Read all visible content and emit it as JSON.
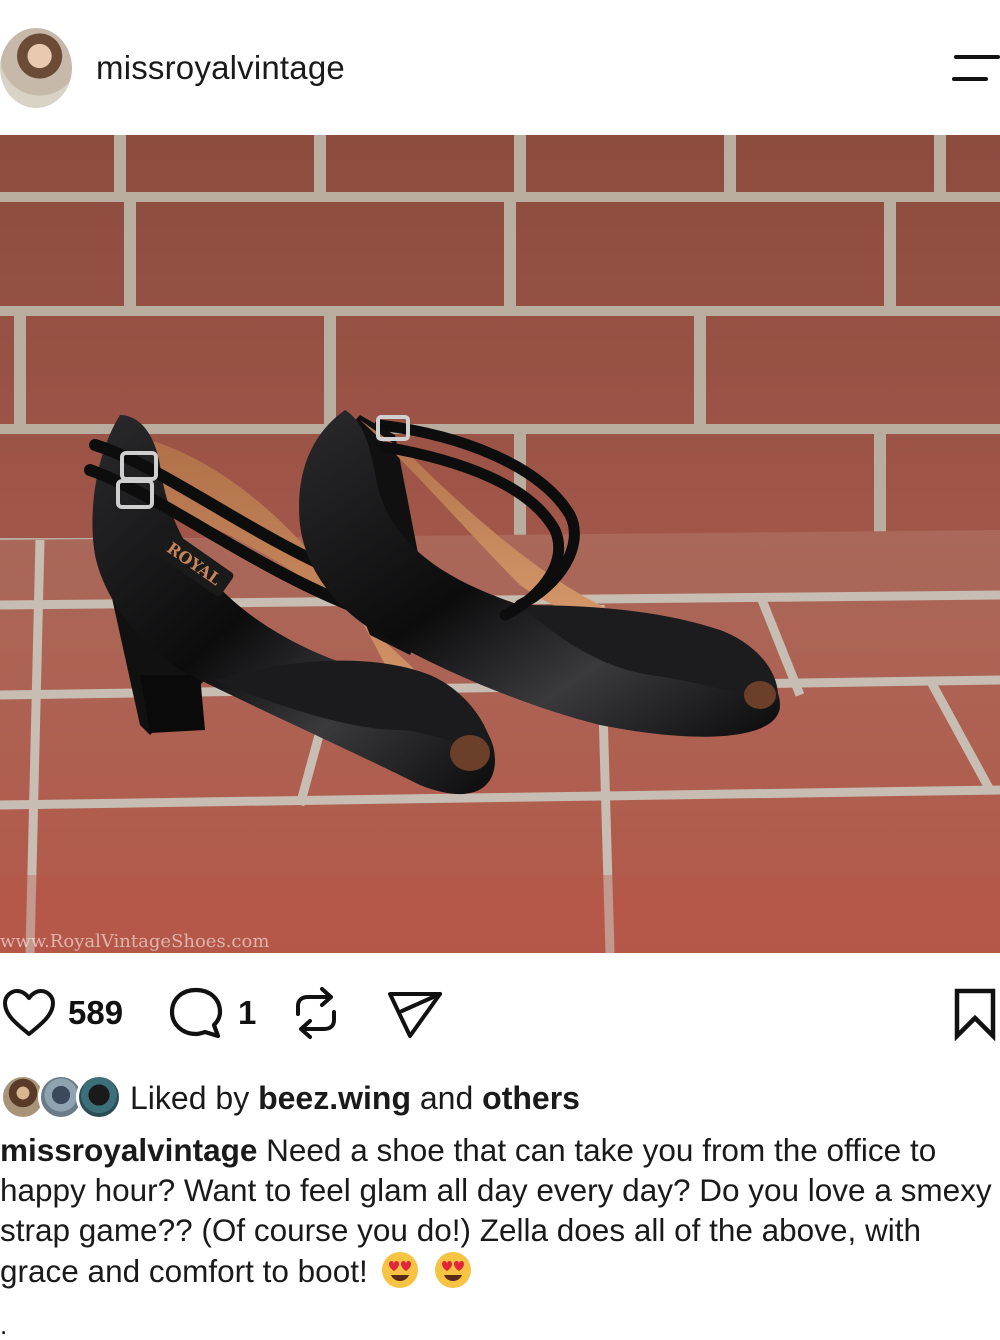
{
  "header": {
    "username": "missroyalvintage"
  },
  "post": {
    "watermark": "www.RoyalVintageShoes.com",
    "insole_brand": "ROYAL"
  },
  "actions": {
    "like_count": "589",
    "comment_count": "1"
  },
  "likes": {
    "prefix": "Liked by",
    "user": "beez.wing",
    "joiner": "and",
    "others": "others"
  },
  "caption": {
    "author": "missroyalvintage",
    "text": "Need a shoe that can take you from the office to happy hour? Want to feel glam all day every day? Do you love a smexy strap game?? (Of course you do!) Zella does all of the above, with grace and comfort to boot!",
    "emojis": [
      "heart-eyes-emoji",
      "heart-eyes-emoji"
    ],
    "trailing": "."
  },
  "colors": {
    "brick": "#9b4a3a",
    "mortar": "#b8aea3",
    "shoe": "#0e0e0f",
    "insole": "#c8845a",
    "emoji_face": "#f6c343",
    "emoji_heart": "#e0263a"
  },
  "icons": [
    "menu-icon",
    "heart-icon",
    "comment-icon",
    "repost-icon",
    "share-icon",
    "bookmark-icon"
  ]
}
